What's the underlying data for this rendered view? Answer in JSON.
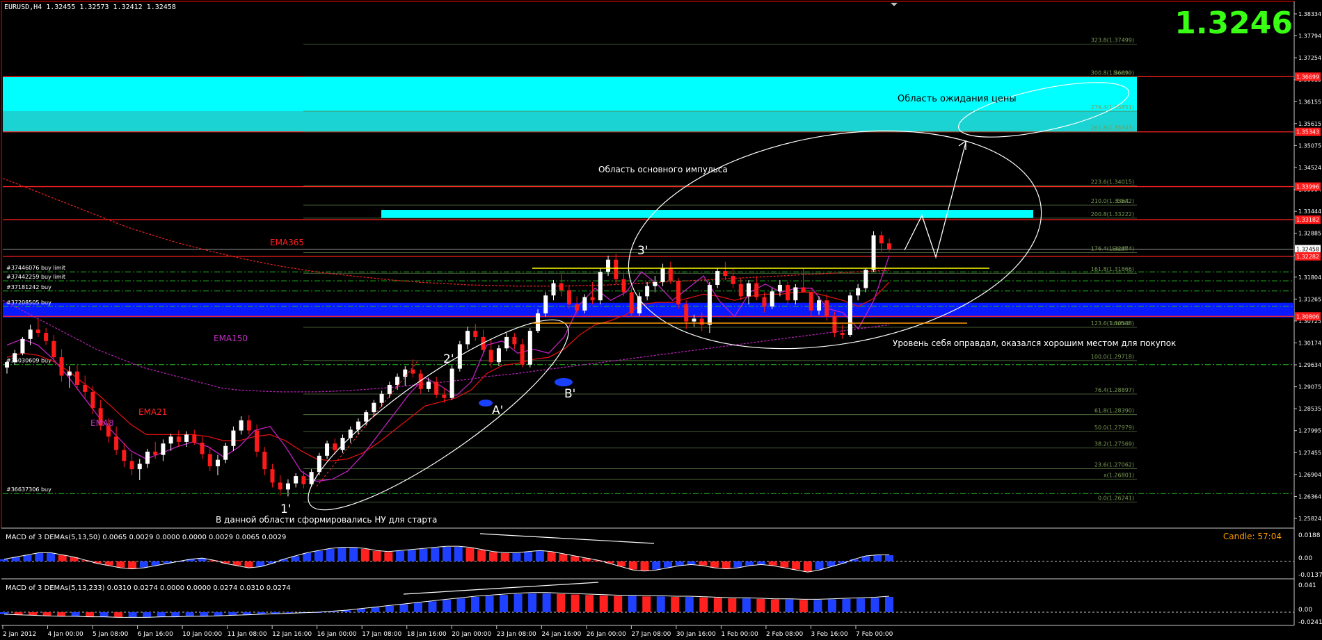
{
  "header": {
    "symbol_line": "EURUSD,H4  1.32455 1.32573 1.32412 1.32458",
    "big_price": "1.3246",
    "big_price_color": "#39ff14"
  },
  "macd1": {
    "title": "MACD of 3 DEMAs(5,13,50) 0.0065 0.0029 0.0000 0.0000 0.0029 0.0065 0.0029",
    "candle_label": "Candle:  57:04",
    "scale": [
      "0.0188",
      "0.00",
      "-0.0137"
    ]
  },
  "macd2": {
    "title": "MACD of 3 DEMAs(5,13,233) 0.0310 0.0274 0.0000 0.0000 0.0274 0.0310 0.0274",
    "scale": [
      "0.041",
      "0.00",
      "-0.0241"
    ]
  },
  "annotations": {
    "expect_zone": "Область ожидания цены",
    "impulse_zone": "Область основного импульса",
    "level_note": "Уровень себя оправдал, оказался хорошим местом для покупок",
    "start_note": "В данной области сформировались НУ для старта",
    "wave_1": "1'",
    "wave_2": "2'",
    "wave_3": "3'",
    "wave_a": "A'",
    "wave_b": "B'",
    "ema365": "EMA365",
    "ema150": "EMA150",
    "ema21": "EMA21",
    "ema8": "EMA8"
  },
  "orders": [
    {
      "label": "#37446076 buy limit",
      "price": 1.319
    },
    {
      "label": "#37442259 buy limit",
      "price": 1.3168
    },
    {
      "label": "#37181242 buy",
      "price": 1.3143
    },
    {
      "label": "#37208505 buy",
      "price": 1.3105
    },
    {
      "label": "#36030609 buy",
      "price": 1.2962
    },
    {
      "label": "#36637306 buy",
      "price": 1.2645
    }
  ],
  "fib_levels": [
    {
      "label": "323.8(1.37499)",
      "price": 1.37499
    },
    {
      "label": "North",
      "label_only": true,
      "price": 1.367
    },
    {
      "label": "300.8(1.36699)",
      "price": 1.36699
    },
    {
      "label": "276.4(1.35851)",
      "price": 1.35851
    },
    {
      "label": "261.8(1.35343)",
      "price": 1.35343
    },
    {
      "label": "223.6(1.34015)",
      "price": 1.34015
    },
    {
      "label": "East",
      "label_only": true,
      "price": 1.3354
    },
    {
      "label": "210.0(1.33542)",
      "price": 1.33542
    },
    {
      "label": "200.8(1.33222)",
      "price": 1.33222
    },
    {
      "label": "South",
      "label_only": true,
      "price": 1.3237
    },
    {
      "label": "176.4(1.32374)",
      "price": 1.32374
    },
    {
      "label": "161.8(1.31866)",
      "price": 1.31866
    },
    {
      "label": "limited",
      "label_only": true,
      "price": 1.3054
    },
    {
      "label": "123.6(1.30538)",
      "price": 1.30538
    },
    {
      "label": "100.0(1.29718)",
      "price": 1.29718
    },
    {
      "label": "76.4(1.28897)",
      "price": 1.28897
    },
    {
      "label": "61.8(1.28390)",
      "price": 1.2839
    },
    {
      "label": "50.0(1.27979)",
      "price": 1.27979
    },
    {
      "label": "38.2(1.27569)",
      "price": 1.27569
    },
    {
      "label": "23.6(1.27062)",
      "price": 1.27062
    },
    {
      "label": "x(1.26801)",
      "price": 1.26801
    },
    {
      "label": "0.0(1.26241)",
      "price": 1.26241
    }
  ],
  "right_axis_ticks": [
    "1.38334",
    "1.37794",
    "1.37254",
    "1.36615",
    "1.36155",
    "1.35615",
    "1.35075",
    "1.34524",
    "1.33984",
    "1.33444",
    "1.32885",
    "1.32344",
    "1.31804",
    "1.31265",
    "1.30725",
    "1.30174",
    "1.29634",
    "1.29075",
    "1.28535",
    "1.27995",
    "1.27455",
    "1.26904",
    "1.26364",
    "1.25824"
  ],
  "right_axis_red_tags": [
    {
      "label": "1.36699",
      "price": 1.36699
    },
    {
      "label": "1.35343",
      "price": 1.35343
    },
    {
      "label": "1.33996",
      "price": 1.33996
    },
    {
      "label": "1.33182",
      "price": 1.33182
    },
    {
      "label": "1.32458",
      "price": 1.32458
    },
    {
      "label": "1.32282",
      "price": 1.32282
    },
    {
      "label": "1.30806",
      "price": 1.30806
    }
  ],
  "time_axis": [
    "2 Jan 2012",
    "4 Jan 00:00",
    "5 Jan 08:00",
    "6 Jan 16:00",
    "10 Jan 00:00",
    "11 Jan 08:00",
    "12 Jan 16:00",
    "16 Jan 00:00",
    "17 Jan 08:00",
    "18 Jan 16:00",
    "20 Jan 00:00",
    "23 Jan 08:00",
    "24 Jan 16:00",
    "26 Jan 00:00",
    "27 Jan 08:00",
    "30 Jan 16:00",
    "1 Feb 00:00",
    "2 Feb 08:00",
    "3 Feb 16:00",
    "7 Feb 00:00"
  ],
  "chart_data": {
    "type": "candlestick",
    "symbol": "EURUSD",
    "timeframe": "H4",
    "ylim": [
      1.256,
      1.3855
    ],
    "open_high_low_close": [
      1.32455,
      1.32573,
      1.32412,
      1.32458
    ],
    "zones": [
      {
        "name": "cyan-upper",
        "from": 1.35343,
        "to": 1.36699,
        "color": "#00ffff"
      },
      {
        "name": "cyan-mid",
        "from": 1.33222,
        "to": 1.33424,
        "color": "#00ffff"
      },
      {
        "name": "blue-support",
        "from": 1.3078,
        "to": 1.3114,
        "color": "#0a1aff"
      }
    ],
    "candles": [
      [
        1.2955,
        1.2972,
        1.294,
        1.2968
      ],
      [
        1.2968,
        1.2998,
        1.2962,
        1.299
      ],
      [
        1.299,
        1.303,
        1.2985,
        1.3025
      ],
      [
        1.3025,
        1.306,
        1.301,
        1.3048
      ],
      [
        1.3048,
        1.3075,
        1.303,
        1.304
      ],
      [
        1.304,
        1.3052,
        1.301,
        1.302
      ],
      [
        1.302,
        1.3035,
        1.2968,
        1.298
      ],
      [
        1.298,
        1.3,
        1.292,
        1.2935
      ],
      [
        1.2935,
        1.2958,
        1.2905,
        1.2945
      ],
      [
        1.2945,
        1.296,
        1.29,
        1.2912
      ],
      [
        1.2912,
        1.2935,
        1.288,
        1.2895
      ],
      [
        1.2895,
        1.291,
        1.284,
        1.2855
      ],
      [
        1.2855,
        1.2875,
        1.28,
        1.2812
      ],
      [
        1.2812,
        1.283,
        1.277,
        1.2785
      ],
      [
        1.2785,
        1.281,
        1.274,
        1.2752
      ],
      [
        1.2752,
        1.277,
        1.271,
        1.2725
      ],
      [
        1.2725,
        1.2745,
        1.269,
        1.2705
      ],
      [
        1.2705,
        1.273,
        1.2678,
        1.2718
      ],
      [
        1.2718,
        1.2755,
        1.2708,
        1.2748
      ],
      [
        1.2748,
        1.2772,
        1.273,
        1.274
      ],
      [
        1.274,
        1.2778,
        1.2725,
        1.2768
      ],
      [
        1.2768,
        1.2792,
        1.275,
        1.2785
      ],
      [
        1.2785,
        1.28,
        1.276,
        1.2772
      ],
      [
        1.2772,
        1.2798,
        1.276,
        1.279
      ],
      [
        1.279,
        1.2802,
        1.2765,
        1.277
      ],
      [
        1.277,
        1.2785,
        1.273,
        1.2742
      ],
      [
        1.2742,
        1.276,
        1.27,
        1.2712
      ],
      [
        1.2712,
        1.274,
        1.269,
        1.2728
      ],
      [
        1.2728,
        1.277,
        1.272,
        1.2762
      ],
      [
        1.2762,
        1.281,
        1.275,
        1.28
      ],
      [
        1.28,
        1.2835,
        1.279,
        1.2825
      ],
      [
        1.2825,
        1.2838,
        1.279,
        1.28
      ],
      [
        1.28,
        1.2815,
        1.2735,
        1.2748
      ],
      [
        1.2748,
        1.276,
        1.269,
        1.2705
      ],
      [
        1.2705,
        1.2718,
        1.266,
        1.2672
      ],
      [
        1.2672,
        1.269,
        1.264,
        1.2655
      ],
      [
        1.2655,
        1.268,
        1.2638,
        1.267
      ],
      [
        1.267,
        1.2695,
        1.266,
        1.2688
      ],
      [
        1.2688,
        1.27,
        1.2658,
        1.2668
      ],
      [
        1.2668,
        1.2705,
        1.2662,
        1.2698
      ],
      [
        1.2698,
        1.2745,
        1.269,
        1.2738
      ],
      [
        1.2738,
        1.2775,
        1.273,
        1.2768
      ],
      [
        1.2768,
        1.278,
        1.274,
        1.2752
      ],
      [
        1.2752,
        1.279,
        1.2745,
        1.2782
      ],
      [
        1.2782,
        1.281,
        1.277,
        1.2802
      ],
      [
        1.2802,
        1.283,
        1.279,
        1.2822
      ],
      [
        1.2822,
        1.285,
        1.2812,
        1.2845
      ],
      [
        1.2845,
        1.2875,
        1.2835,
        1.2868
      ],
      [
        1.2868,
        1.2898,
        1.2858,
        1.289
      ],
      [
        1.289,
        1.292,
        1.288,
        1.2912
      ],
      [
        1.2912,
        1.294,
        1.29,
        1.2932
      ],
      [
        1.2932,
        1.2958,
        1.291,
        1.295
      ],
      [
        1.295,
        1.2975,
        1.293,
        1.294
      ],
      [
        1.294,
        1.295,
        1.289,
        1.2902
      ],
      [
        1.2902,
        1.293,
        1.2895,
        1.292
      ],
      [
        1.292,
        1.2932,
        1.288,
        1.2888
      ],
      [
        1.2888,
        1.2905,
        1.2868,
        1.288
      ],
      [
        1.288,
        1.296,
        1.2875,
        1.2952
      ],
      [
        1.2952,
        1.302,
        1.2945,
        1.3012
      ],
      [
        1.3012,
        1.3055,
        1.3,
        1.3045
      ],
      [
        1.3045,
        1.3062,
        1.302,
        1.303
      ],
      [
        1.303,
        1.3048,
        1.2988,
        1.2998
      ],
      [
        1.2998,
        1.3025,
        1.2955,
        1.2968
      ],
      [
        1.2968,
        1.301,
        1.2958,
        1.3002
      ],
      [
        1.3002,
        1.304,
        1.2995,
        1.303
      ],
      [
        1.303,
        1.304,
        1.3,
        1.3012
      ],
      [
        1.3012,
        1.3025,
        1.2955,
        1.2962
      ],
      [
        1.2962,
        1.3052,
        1.2955,
        1.3045
      ],
      [
        1.3045,
        1.3098,
        1.304,
        1.3088
      ],
      [
        1.3088,
        1.314,
        1.308,
        1.3132
      ],
      [
        1.3132,
        1.317,
        1.312,
        1.3162
      ],
      [
        1.3162,
        1.3185,
        1.313,
        1.3145
      ],
      [
        1.3145,
        1.3158,
        1.31,
        1.311
      ],
      [
        1.311,
        1.313,
        1.3085,
        1.3095
      ],
      [
        1.3095,
        1.3135,
        1.3088,
        1.3128
      ],
      [
        1.3128,
        1.3165,
        1.311,
        1.312
      ],
      [
        1.312,
        1.32,
        1.311,
        1.319
      ],
      [
        1.319,
        1.323,
        1.318,
        1.322
      ],
      [
        1.322,
        1.3235,
        1.316,
        1.3172
      ],
      [
        1.3172,
        1.3185,
        1.313,
        1.314
      ],
      [
        1.314,
        1.315,
        1.308,
        1.3088
      ],
      [
        1.3088,
        1.314,
        1.3082,
        1.313
      ],
      [
        1.313,
        1.3165,
        1.312,
        1.3155
      ],
      [
        1.3155,
        1.318,
        1.314,
        1.3165
      ],
      [
        1.3165,
        1.321,
        1.3155,
        1.32
      ],
      [
        1.32,
        1.3215,
        1.316,
        1.3168
      ],
      [
        1.3168,
        1.3175,
        1.31,
        1.311
      ],
      [
        1.311,
        1.312,
        1.305,
        1.3068
      ],
      [
        1.3068,
        1.3085,
        1.3055,
        1.3075
      ],
      [
        1.3075,
        1.309,
        1.3045,
        1.306
      ],
      [
        1.306,
        1.3165,
        1.304,
        1.3158
      ],
      [
        1.3158,
        1.32,
        1.315,
        1.3192
      ],
      [
        1.3192,
        1.3215,
        1.317,
        1.318
      ],
      [
        1.318,
        1.32,
        1.315,
        1.316
      ],
      [
        1.316,
        1.3175,
        1.312,
        1.313
      ],
      [
        1.313,
        1.317,
        1.311,
        1.3162
      ],
      [
        1.3162,
        1.318,
        1.312,
        1.3128
      ],
      [
        1.3128,
        1.314,
        1.309,
        1.3105
      ],
      [
        1.3105,
        1.315,
        1.3098,
        1.3142
      ],
      [
        1.3142,
        1.317,
        1.313,
        1.3158
      ],
      [
        1.3158,
        1.3165,
        1.311,
        1.312
      ],
      [
        1.312,
        1.316,
        1.311,
        1.3152
      ],
      [
        1.3152,
        1.32,
        1.3145,
        1.314
      ],
      [
        1.314,
        1.315,
        1.308,
        1.3095
      ],
      [
        1.3095,
        1.313,
        1.3085,
        1.312
      ],
      [
        1.312,
        1.3135,
        1.307,
        1.308
      ],
      [
        1.308,
        1.3092,
        1.303,
        1.304
      ],
      [
        1.304,
        1.306,
        1.3025,
        1.3035
      ],
      [
        1.3035,
        1.314,
        1.303,
        1.3132
      ],
      [
        1.3132,
        1.316,
        1.312,
        1.315
      ],
      [
        1.315,
        1.32,
        1.314,
        1.3195
      ],
      [
        1.3195,
        1.329,
        1.319,
        1.328
      ],
      [
        1.328,
        1.329,
        1.324,
        1.326
      ],
      [
        1.326,
        1.3272,
        1.324,
        1.3246
      ]
    ],
    "ema8": [
      1.301,
      1.3025,
      1.301,
      1.2975,
      1.293,
      1.288,
      1.283,
      1.279,
      1.275,
      1.273,
      1.2745,
      1.276,
      1.2772,
      1.276,
      1.2735,
      1.276,
      1.28,
      1.281,
      1.276,
      1.27,
      1.2675,
      1.268,
      1.27,
      1.274,
      1.279,
      1.284,
      1.289,
      1.293,
      1.291,
      1.2885,
      1.292,
      1.301,
      1.302,
      1.299,
      1.3,
      1.299,
      1.303,
      1.311,
      1.315,
      1.312,
      1.314,
      1.319,
      1.316,
      1.312,
      1.315,
      1.318,
      1.312,
      1.308,
      1.314,
      1.316,
      1.314,
      1.315,
      1.315,
      1.31,
      1.309,
      1.305,
      1.312,
      1.323
    ],
    "ema21": [
      1.298,
      1.299,
      1.2985,
      1.297,
      1.2945,
      1.2915,
      1.2885,
      1.285,
      1.2815,
      1.279,
      1.279,
      1.279,
      1.279,
      1.2785,
      1.2775,
      1.2775,
      1.2785,
      1.279,
      1.2775,
      1.275,
      1.273,
      1.2725,
      1.273,
      1.2745,
      1.277,
      1.28,
      1.283,
      1.286,
      1.287,
      1.288,
      1.29,
      1.294,
      1.296,
      1.2965,
      1.2975,
      1.298,
      1.3,
      1.3035,
      1.306,
      1.307,
      1.3085,
      1.311,
      1.3115,
      1.3115,
      1.3125,
      1.3135,
      1.313,
      1.312,
      1.313,
      1.3135,
      1.3135,
      1.314,
      1.314,
      1.313,
      1.312,
      1.3105,
      1.3125,
      1.3165
    ],
    "ema150": [
      1.312,
      1.31,
      1.308,
      1.306,
      1.304,
      1.302,
      1.3,
      1.2985,
      1.297,
      1.2955,
      1.2945,
      1.2935,
      1.2925,
      1.2915,
      1.2905,
      1.29,
      1.2898,
      1.2896,
      1.2895,
      1.2895,
      1.2895,
      1.2896,
      1.2898,
      1.29,
      1.2903,
      1.2906,
      1.291,
      1.2914,
      1.2918,
      1.2922,
      1.2926,
      1.2932,
      1.2936,
      1.294,
      1.2945,
      1.295,
      1.2955,
      1.296,
      1.2965,
      1.297,
      1.2975,
      1.298,
      1.2985,
      1.299,
      1.2995,
      1.3,
      1.3005,
      1.301,
      1.3015,
      1.302,
      1.3025,
      1.303,
      1.3035,
      1.304,
      1.3045,
      1.305,
      1.3055,
      1.306
    ],
    "ema365": [
      1.342,
      1.3405,
      1.339,
      1.3375,
      1.336,
      1.3345,
      1.333,
      1.3315,
      1.33,
      1.3288,
      1.3276,
      1.3264,
      1.3254,
      1.3244,
      1.3235,
      1.3226,
      1.3218,
      1.321,
      1.3203,
      1.3197,
      1.3191,
      1.3186,
      1.3182,
      1.3178,
      1.3174,
      1.317,
      1.3167,
      1.3164,
      1.3162,
      1.316,
      1.3158,
      1.3157,
      1.3156,
      1.3155,
      1.3155,
      1.3155,
      1.3155,
      1.3156,
      1.3157,
      1.3158,
      1.316,
      1.3162,
      1.3164,
      1.3166,
      1.3168,
      1.317,
      1.3172,
      1.3174,
      1.3176,
      1.3178,
      1.318,
      1.3182,
      1.3184,
      1.3186,
      1.3188,
      1.319,
      1.3192,
      1.3194
    ],
    "macd1_hist": [
      0.002,
      0.004,
      0.006,
      0.008,
      0.008,
      0.006,
      0.004,
      0.001,
      -0.002,
      -0.004,
      -0.006,
      -0.007,
      -0.006,
      -0.004,
      -0.002,
      0.0,
      0.002,
      0.003,
      0.001,
      -0.002,
      -0.004,
      -0.006,
      -0.005,
      -0.002,
      0.002,
      0.005,
      0.008,
      0.01,
      0.012,
      0.013,
      0.013,
      0.012,
      0.01,
      0.009,
      0.01,
      0.011,
      0.012,
      0.013,
      0.014,
      0.014,
      0.013,
      0.011,
      0.009,
      0.008,
      0.008,
      0.009,
      0.01,
      0.009,
      0.007,
      0.005,
      0.003,
      0.001,
      -0.002,
      -0.005,
      -0.008,
      -0.009,
      -0.008,
      -0.006,
      -0.004,
      -0.003,
      -0.004,
      -0.006,
      -0.007,
      -0.006,
      -0.004,
      -0.003,
      -0.004,
      -0.006,
      -0.008,
      -0.01,
      -0.008,
      -0.005,
      -0.002,
      0.002,
      0.005,
      0.006,
      0.006
    ],
    "macd2_hist": [
      -0.004,
      -0.005,
      -0.006,
      -0.007,
      -0.008,
      -0.008,
      -0.009,
      -0.009,
      -0.01,
      -0.01,
      -0.01,
      -0.009,
      -0.009,
      -0.008,
      -0.008,
      -0.007,
      -0.006,
      -0.005,
      -0.004,
      -0.003,
      -0.002,
      -0.001,
      0.0,
      0.002,
      0.004,
      0.007,
      0.01,
      0.013,
      0.016,
      0.019,
      0.022,
      0.025,
      0.028,
      0.031,
      0.033,
      0.035,
      0.037,
      0.038,
      0.038,
      0.037,
      0.036,
      0.035,
      0.034,
      0.033,
      0.033,
      0.032,
      0.032,
      0.031,
      0.031,
      0.03,
      0.029,
      0.028,
      0.028,
      0.027,
      0.026,
      0.026,
      0.025,
      0.025,
      0.026,
      0.027,
      0.028,
      0.029,
      0.031
    ],
    "macd1_ylim": [
      -0.0137,
      0.0188
    ],
    "macd2_ylim": [
      -0.0241,
      0.041
    ]
  }
}
